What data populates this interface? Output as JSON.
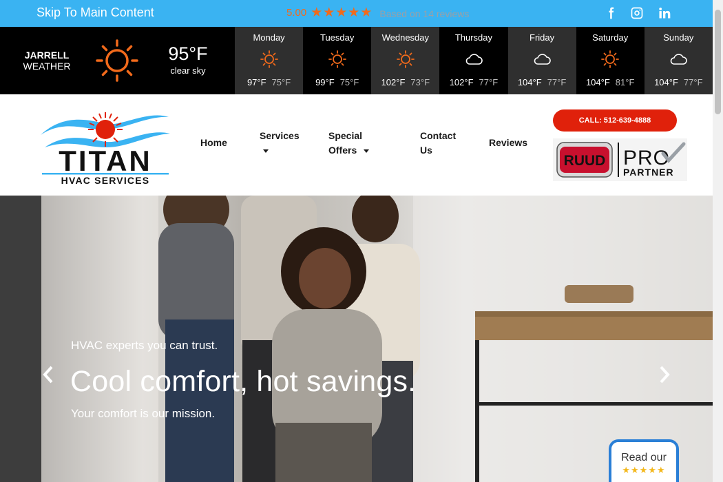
{
  "topbar": {
    "skip_link": "Skip To Main Content",
    "rating_score": "5.00",
    "rating_stars": "★★★★★",
    "rating_text": "Based on 14 reviews",
    "social": [
      {
        "name": "facebook-icon"
      },
      {
        "name": "instagram-icon"
      },
      {
        "name": "linkedin-icon"
      }
    ]
  },
  "weather": {
    "city": "JARRELL",
    "label": "WEATHER",
    "current_temp": "95°F",
    "condition": "clear sky",
    "current_icon": "sun-icon",
    "days": [
      {
        "name": "Monday",
        "icon": "sun",
        "high": "97°F",
        "low": "75°F"
      },
      {
        "name": "Tuesday",
        "icon": "sun",
        "high": "99°F",
        "low": "75°F"
      },
      {
        "name": "Wednesday",
        "icon": "sun",
        "high": "102°F",
        "low": "73°F"
      },
      {
        "name": "Thursday",
        "icon": "cloud",
        "high": "102°F",
        "low": "77°F"
      },
      {
        "name": "Friday",
        "icon": "cloud",
        "high": "104°F",
        "low": "77°F"
      },
      {
        "name": "Saturday",
        "icon": "sun",
        "high": "104°F",
        "low": "81°F"
      },
      {
        "name": "Sunday",
        "icon": "cloud",
        "high": "104°F",
        "low": "77°F"
      }
    ]
  },
  "header": {
    "logo_title": "TITAN",
    "logo_subtitle": "HVAC SERVICES",
    "nav": {
      "home": "Home",
      "services": "Services",
      "special_1": "Special",
      "special_2": "Offers",
      "contact_1": "Contact",
      "contact_2": "Us",
      "reviews": "Reviews"
    },
    "call_button": "CALL: 512-639-4888",
    "partner_logo": {
      "brand": "RUUD",
      "pro": "PRO",
      "partner": "PARTNER"
    }
  },
  "hero": {
    "kicker": "HVAC experts you can trust.",
    "headline": "Cool comfort, hot savings.",
    "sub": "Your comfort is our mission.",
    "badge_text": "Read our",
    "badge_stars": "★★★★★"
  },
  "colors": {
    "topbar": "#3ab3f2",
    "accent_orange": "#f26a1b",
    "call_red": "#e0210b",
    "weather_bg": "#000000",
    "badge_blue": "#2a7fd6"
  }
}
